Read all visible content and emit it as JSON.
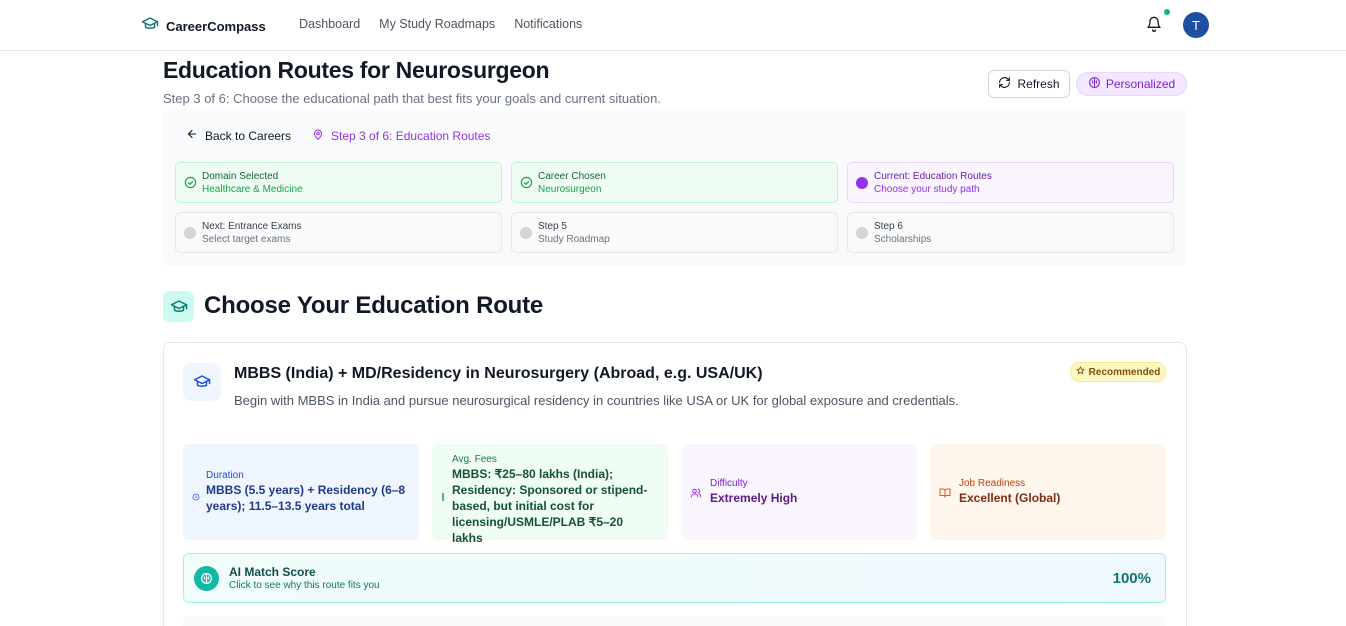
{
  "nav": {
    "brand": "CareerCompass",
    "links": [
      "Dashboard",
      "My Study Roadmaps",
      "Notifications"
    ],
    "avatar_initial": "T"
  },
  "header": {
    "title": "Education Routes for Neurosurgeon",
    "subtitle": "Step 3 of 6: Choose the educational path that best fits your goals and current situation.",
    "refresh_label": "Refresh",
    "personalized_label": "Personalized"
  },
  "progress": {
    "back_label": "Back to Careers",
    "step_label": "Step 3 of 6: Education Routes",
    "steps": [
      {
        "title": "Domain Selected",
        "desc": "Healthcare & Medicine",
        "state": "done"
      },
      {
        "title": "Career Chosen",
        "desc": "Neurosurgeon",
        "state": "done"
      },
      {
        "title": "Current: Education Routes",
        "desc": "Choose your study path",
        "state": "current"
      },
      {
        "title": "Next: Entrance Exams",
        "desc": "Select target exams",
        "state": "pending"
      },
      {
        "title": "Step 5",
        "desc": "Study Roadmap",
        "state": "pending"
      },
      {
        "title": "Step 6",
        "desc": "Scholarships",
        "state": "pending"
      }
    ]
  },
  "section": {
    "title": "Choose Your Education Route"
  },
  "route": {
    "title": "MBBS (India) + MD/Residency in Neurosurgery (Abroad, e.g. USA/UK)",
    "description": "Begin with MBBS in India and pursue neurosurgical residency in countries like USA or UK for global exposure and credentials.",
    "badge": "Recommended",
    "duration_label": "Duration",
    "duration_value": "MBBS (5.5 years) + Residency (6–8 years); 11.5–13.5 years total",
    "fees_label": "Avg. Fees",
    "fees_value": "MBBS: ₹25–80 lakhs (India); Residency: Sponsored or stipend-based, but initial cost for licensing/USMLE/PLAB ₹5–20 lakhs",
    "difficulty_label": "Difficulty",
    "difficulty_value": "Extremely High",
    "job_label": "Job Readiness",
    "job_value": "Excellent (Global)",
    "ai_title": "AI Match Score",
    "ai_sub": "Click to see why this route fits you",
    "ai_score": "100%"
  },
  "colors": {
    "brand": "#0f766e",
    "accent_purple": "#9333ea",
    "success": "#16a34a",
    "avatar": "#1e4fa0"
  }
}
